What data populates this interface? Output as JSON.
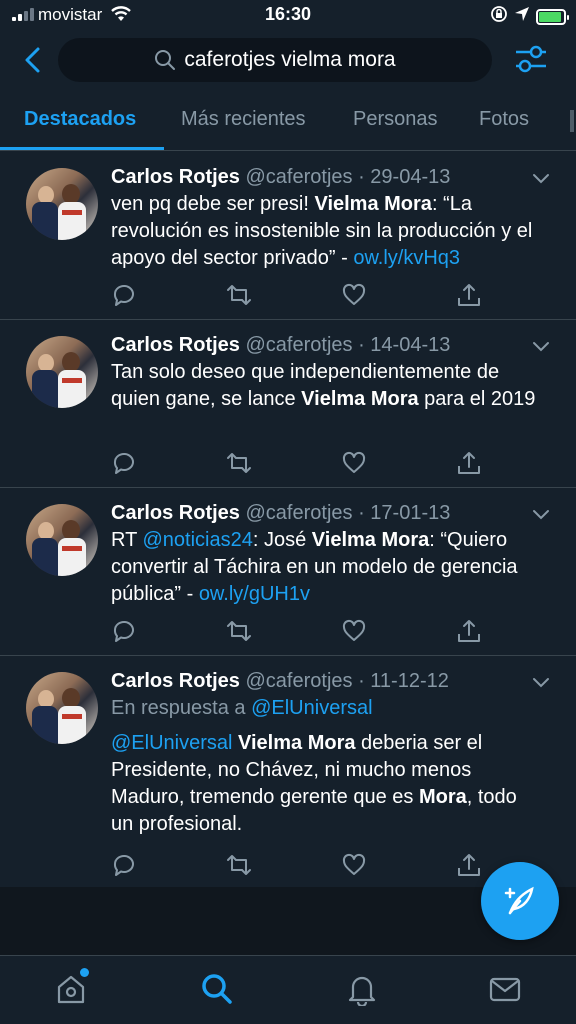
{
  "status_bar": {
    "carrier": "movistar",
    "time": "16:30"
  },
  "search": {
    "query": "caferotjes vielma mora"
  },
  "tabs": [
    {
      "label": "Destacados",
      "active": true
    },
    {
      "label": "Más recientes",
      "active": false
    },
    {
      "label": "Personas",
      "active": false
    },
    {
      "label": "Fotos",
      "active": false
    }
  ],
  "tweets": [
    {
      "name": "Carlos Rotjes",
      "handle": "@caferotjes",
      "date": "29-04-13",
      "segments": [
        {
          "text": "ven pq debe ser presi! ",
          "style": "normal"
        },
        {
          "text": "Vielma Mora",
          "style": "bold"
        },
        {
          "text": ": “La revolución es insostenible sin la producción y el apoyo del sector privado” - ",
          "style": "normal"
        },
        {
          "text": "ow.ly/kvHq3",
          "style": "link"
        }
      ]
    },
    {
      "name": "Carlos Rotjes",
      "handle": "@caferotjes",
      "date": "14-04-13",
      "segments": [
        {
          "text": "Tan solo deseo que independientemente de quien gane, se lance ",
          "style": "normal"
        },
        {
          "text": "Vielma Mora",
          "style": "bold"
        },
        {
          "text": " para el 2019",
          "style": "normal"
        }
      ]
    },
    {
      "name": "Carlos Rotjes",
      "handle": "@caferotjes",
      "date": "17-01-13",
      "segments": [
        {
          "text": "RT ",
          "style": "normal"
        },
        {
          "text": "@noticias24",
          "style": "link"
        },
        {
          "text": ": José ",
          "style": "normal"
        },
        {
          "text": "Vielma Mora",
          "style": "bold"
        },
        {
          "text": ": “Quiero convertir al Táchira en un modelo de gerencia pública” - ",
          "style": "normal"
        },
        {
          "text": "ow.ly/gUH1v",
          "style": "link"
        }
      ]
    },
    {
      "name": "Carlos Rotjes",
      "handle": "@caferotjes",
      "date": "11-12-12",
      "reply_prefix": "En respuesta a ",
      "reply_handle": "@ElUniversal",
      "segments": [
        {
          "text": "@ElUniversal",
          "style": "link"
        },
        {
          "text": " ",
          "style": "normal"
        },
        {
          "text": "Vielma Mora",
          "style": "bold"
        },
        {
          "text": " deberia ser el Presidente, no Chávez, ni mucho menos Maduro, tremendo gerente que es ",
          "style": "normal"
        },
        {
          "text": "Mora",
          "style": "bold"
        },
        {
          "text": ", todo un profesional.",
          "style": "normal"
        }
      ]
    }
  ],
  "colors": {
    "background": "#15202b",
    "accent": "#1da1f2",
    "muted": "#8899a6",
    "divider": "#38444d",
    "battery": "#4cd964"
  },
  "icons": {
    "back": "chevron-left-icon",
    "search": "search-icon",
    "filter": "sliders-icon",
    "reply": "comment-icon",
    "retweet": "retweet-icon",
    "like": "heart-icon",
    "share": "share-icon",
    "compose": "compose-feather-icon",
    "nav": [
      "home-icon",
      "search-icon",
      "bell-icon",
      "mail-icon"
    ]
  }
}
